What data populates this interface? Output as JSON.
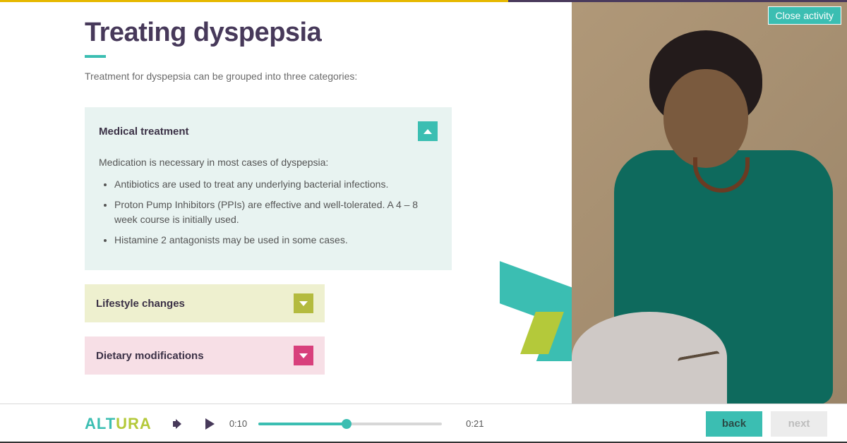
{
  "colors": {
    "teal": "#3bbeb2",
    "olive": "#b4bb3f",
    "pink": "#d8407c",
    "heading": "#47395a"
  },
  "header": {
    "close_label": "Close activity"
  },
  "page": {
    "title": "Treating dyspepsia",
    "intro": "Treatment for dyspepsia can be grouped into three categories:"
  },
  "accordion": {
    "items": [
      {
        "title": "Medical treatment",
        "expanded": true,
        "body_lead": "Medication is necessary in most cases of dyspepsia:",
        "bullets": [
          "Antibiotics are used to treat any underlying bacterial infections.",
          "Proton Pump Inhibitors (PPIs) are effective and well-tolerated. A 4 – 8 week course is initially used.",
          "Histamine 2 antagonists may be used in some cases."
        ]
      },
      {
        "title": "Lifestyle changes",
        "expanded": false
      },
      {
        "title": "Dietary modifications",
        "expanded": false
      }
    ]
  },
  "brand": {
    "name": "ALTURA"
  },
  "player": {
    "current_time": "0:10",
    "duration": "0:21",
    "progress_percent": 48
  },
  "nav": {
    "back_label": "back",
    "next_label": "next"
  }
}
